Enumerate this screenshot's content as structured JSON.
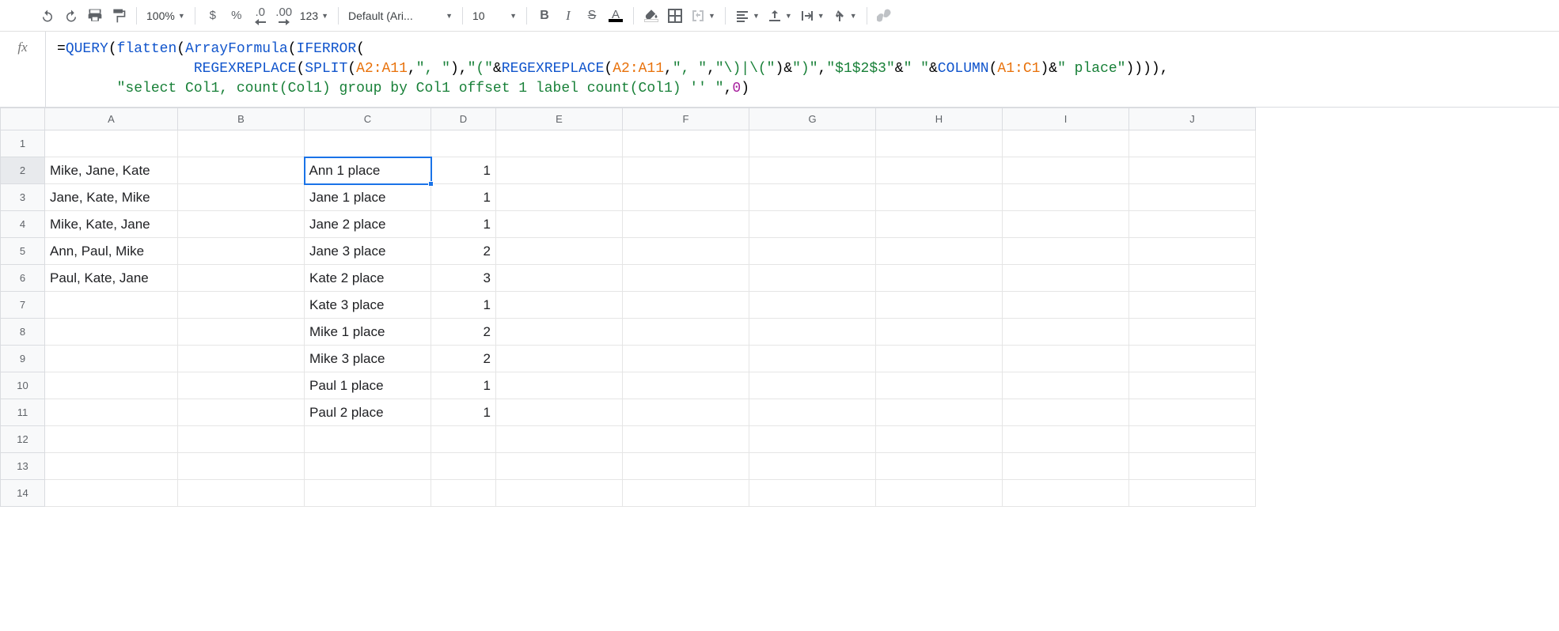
{
  "toolbar": {
    "zoom": "100%",
    "currency": "$",
    "percent": "%",
    "dec_dec": ".0",
    "inc_dec": ".00",
    "more_num": "123",
    "font": "Default (Ari...",
    "font_size": "10",
    "bold": "B",
    "italic": "I",
    "strike": "S",
    "text_color": "A"
  },
  "formula": {
    "prefix": "=",
    "t0": "QUERY",
    "p0": "(",
    "t1": "flatten",
    "p1": "(",
    "t2": "ArrayFormula",
    "p2": "(",
    "t3": "IFERROR",
    "p3": "(",
    "t4": "REGEXREPLACE",
    "p4": "(",
    "t5": "SPLIT",
    "p5": "(",
    "r0": "A2:A11",
    "c0": ",",
    "s0": "\", \"",
    "p6": ")",
    "c1": ",",
    "s1": "\"(\"",
    "amp0": "&",
    "t6": "REGEXREPLACE",
    "p7": "(",
    "r1": "A2:A11",
    "c2": ",",
    "s2": "\", \"",
    "c3": ",",
    "s3": "\"\\)|\\(\"",
    "p8": ")",
    "amp1": "&",
    "s4": "\")\"",
    "c4": ",",
    "s5": "\"$1$2$3\"",
    "amp2": "&",
    "s6": "\" \"",
    "amp3": "&",
    "t7": "COLUMN",
    "p9": "(",
    "r2": "A1:C1",
    "p10": ")",
    "amp4": "&",
    "s7": "\" place\"",
    "p11": "))))",
    "c5": ",",
    "s8": "\"select Col1, count(Col1) group by Col1 offset 1 label count(Col1) '' \"",
    "c6": ",",
    "n0": "0",
    "p12": ")"
  },
  "columns": [
    "A",
    "B",
    "C",
    "D",
    "E",
    "F",
    "G",
    "H",
    "I",
    "J"
  ],
  "rows": [
    {
      "n": "1",
      "A": "",
      "C": "",
      "D": ""
    },
    {
      "n": "2",
      "A": "Mike, Jane, Kate",
      "C": "Ann 1 place",
      "D": "1"
    },
    {
      "n": "3",
      "A": "Jane, Kate, Mike",
      "C": "Jane 1 place",
      "D": "1"
    },
    {
      "n": "4",
      "A": "Mike, Kate, Jane",
      "C": "Jane 2 place",
      "D": "1"
    },
    {
      "n": "5",
      "A": "Ann, Paul, Mike",
      "C": "Jane 3 place",
      "D": "2"
    },
    {
      "n": "6",
      "A": "Paul, Kate, Jane",
      "C": "Kate 2 place",
      "D": "3"
    },
    {
      "n": "7",
      "A": "",
      "C": "Kate 3 place",
      "D": "1"
    },
    {
      "n": "8",
      "A": "",
      "C": "Mike 1 place",
      "D": "2"
    },
    {
      "n": "9",
      "A": "",
      "C": "Mike 3 place",
      "D": "2"
    },
    {
      "n": "10",
      "A": "",
      "C": "Paul 1 place",
      "D": "1"
    },
    {
      "n": "11",
      "A": "",
      "C": "Paul 2 place",
      "D": "1"
    },
    {
      "n": "12",
      "A": "",
      "C": "",
      "D": ""
    },
    {
      "n": "13",
      "A": "",
      "C": "",
      "D": ""
    },
    {
      "n": "14",
      "A": "",
      "C": "",
      "D": ""
    }
  ],
  "active_cell": "C2"
}
